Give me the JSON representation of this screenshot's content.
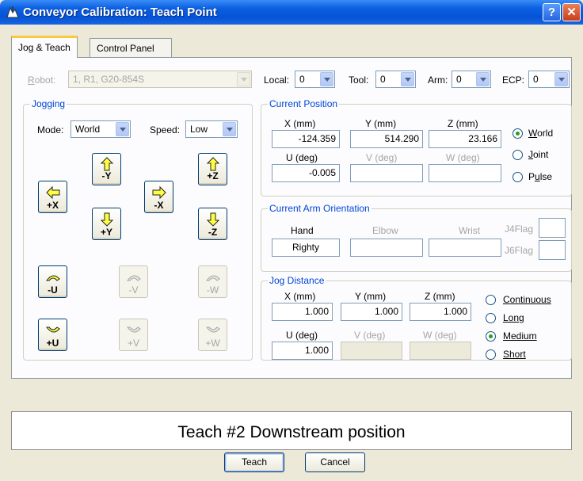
{
  "window": {
    "title": "Conveyor Calibration: Teach Point",
    "help_label": "?",
    "close_label": "✕"
  },
  "tabs": [
    "Jog & Teach",
    "Control Panel"
  ],
  "robot": {
    "label": "Robot:",
    "value": "1, R1, G20-854S"
  },
  "selectors": [
    {
      "label": "Local:",
      "value": "0"
    },
    {
      "label": "Tool:",
      "value": "0"
    },
    {
      "label": "Arm:",
      "value": "0"
    },
    {
      "label": "ECP:",
      "value": "0"
    }
  ],
  "jogging": {
    "title": "Jogging",
    "mode_label": "Mode:",
    "mode_value": "World",
    "speed_label": "Speed:",
    "speed_value": "Low",
    "buttons": {
      "plus_x": "+X",
      "minus_y": "-Y",
      "minus_x": "-X",
      "plus_y": "+Y",
      "plus_z": "+Z",
      "minus_z": "-Z",
      "minus_u": "-U",
      "minus_v": "-V",
      "minus_w": "-W",
      "plus_u": "+U",
      "plus_v": "+V",
      "plus_w": "+W"
    }
  },
  "current_position": {
    "title": "Current Position",
    "labels": {
      "x": "X (mm)",
      "y": "Y (mm)",
      "z": "Z (mm)",
      "u": "U (deg)",
      "v": "V (deg)",
      "w": "W (deg)"
    },
    "values": {
      "x": "-124.359",
      "y": "514.290",
      "z": "23.166",
      "u": "-0.005",
      "v": "",
      "w": ""
    },
    "modes": [
      "World",
      "Joint",
      "Pulse"
    ],
    "selected_mode": "World"
  },
  "arm_orientation": {
    "title": "Current Arm Orientation",
    "labels": {
      "hand": "Hand",
      "elbow": "Elbow",
      "wrist": "Wrist",
      "j4flag": "J4Flag",
      "j6flag": "J6Flag"
    },
    "values": {
      "hand": "Righty",
      "elbow": "",
      "wrist": "",
      "j4flag": "",
      "j6flag": ""
    }
  },
  "jog_distance": {
    "title": "Jog Distance",
    "labels": {
      "x": "X (mm)",
      "y": "Y (mm)",
      "z": "Z (mm)",
      "u": "U (deg)",
      "v": "V (deg)",
      "w": "W (deg)"
    },
    "values": {
      "x": "1.000",
      "y": "1.000",
      "z": "1.000",
      "u": "1.000",
      "v": "",
      "w": ""
    },
    "options": [
      "Continuous",
      "Long",
      "Medium",
      "Short"
    ],
    "selected": "Medium"
  },
  "message": "Teach #2 Downstream position",
  "buttons": {
    "teach": "Teach",
    "cancel": "Cancel"
  },
  "colors": {
    "title_bar": "#0553d6",
    "group_title": "#0046d5",
    "tab_highlight": "#ffc73c",
    "jog_arrow": "#ffff40",
    "radio_selected": "#21a121"
  }
}
